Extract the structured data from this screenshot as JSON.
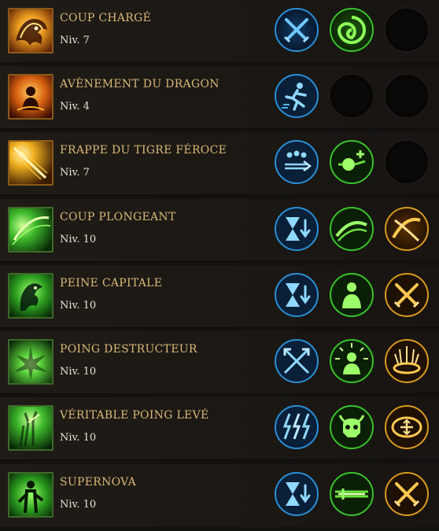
{
  "level_prefix": "Niv.",
  "colors": {
    "name": "#d9b877",
    "level": "#e8e2d6",
    "blue": "#2a8fd6",
    "green": "#39c22a",
    "orange": "#d99a1e",
    "fire": "#e08a10"
  },
  "skills": [
    {
      "name": "COUP CHARGÉ",
      "level": "Niv. 7",
      "icon": "fire-dragon-icon",
      "runes": [
        {
          "icon": "crossed-swords-icon",
          "color": "blue"
        },
        {
          "icon": "green-swirl-icon",
          "color": "green"
        },
        {
          "icon": "empty-rune-slot",
          "color": "none"
        }
      ]
    },
    {
      "name": "AVÈNEMENT DU DRAGON",
      "level": "Niv. 4",
      "icon": "meditating-monk-fire-icon",
      "runes": [
        {
          "icon": "running-figure-icon",
          "color": "blue"
        },
        {
          "icon": "empty-rune-slot",
          "color": "none"
        },
        {
          "icon": "empty-rune-slot",
          "color": "none"
        }
      ]
    },
    {
      "name": "FRAPPE DU TIGRE FÉROCE",
      "level": "Niv. 7",
      "icon": "fire-slash-icon",
      "runes": [
        {
          "icon": "group-sword-icon",
          "color": "blue"
        },
        {
          "icon": "orb-plus-icon",
          "color": "green"
        },
        {
          "icon": "empty-rune-slot",
          "color": "none"
        }
      ]
    },
    {
      "name": "COUP PLONGEANT",
      "level": "Niv. 10",
      "icon": "green-slash-icon",
      "runes": [
        {
          "icon": "hourglass-down-icon",
          "color": "blue"
        },
        {
          "icon": "green-wave-slash-icon",
          "color": "green"
        },
        {
          "icon": "orange-crossed-slash-icon",
          "color": "orange"
        }
      ]
    },
    {
      "name": "PEINE CAPITALE",
      "level": "Niv. 10",
      "icon": "green-dragon-head-icon",
      "runes": [
        {
          "icon": "hourglass-down-icon",
          "color": "blue"
        },
        {
          "icon": "person-silhouette-icon",
          "color": "green"
        },
        {
          "icon": "crossed-swords-icon",
          "color": "orange"
        }
      ]
    },
    {
      "name": "POING DESTRUCTEUR",
      "level": "Niv. 10",
      "icon": "green-explosion-icon",
      "runes": [
        {
          "icon": "crossed-arrows-icon",
          "color": "blue"
        },
        {
          "icon": "person-burst-icon",
          "color": "green"
        },
        {
          "icon": "impact-ground-icon",
          "color": "orange"
        }
      ]
    },
    {
      "name": "VÉRITABLE POING LEVÉ",
      "level": "Niv. 10",
      "icon": "green-rising-fist-icon",
      "runes": [
        {
          "icon": "lightning-bolts-icon",
          "color": "blue"
        },
        {
          "icon": "demon-skull-icon",
          "color": "green"
        },
        {
          "icon": "target-arrows-icon",
          "color": "orange"
        }
      ]
    },
    {
      "name": "SUPERNOVA",
      "level": "Niv. 10",
      "icon": "green-warrior-icon",
      "runes": [
        {
          "icon": "hourglass-down-icon",
          "color": "blue"
        },
        {
          "icon": "green-sword-beam-icon",
          "color": "green"
        },
        {
          "icon": "crossed-swords-icon",
          "color": "orange"
        }
      ]
    }
  ]
}
